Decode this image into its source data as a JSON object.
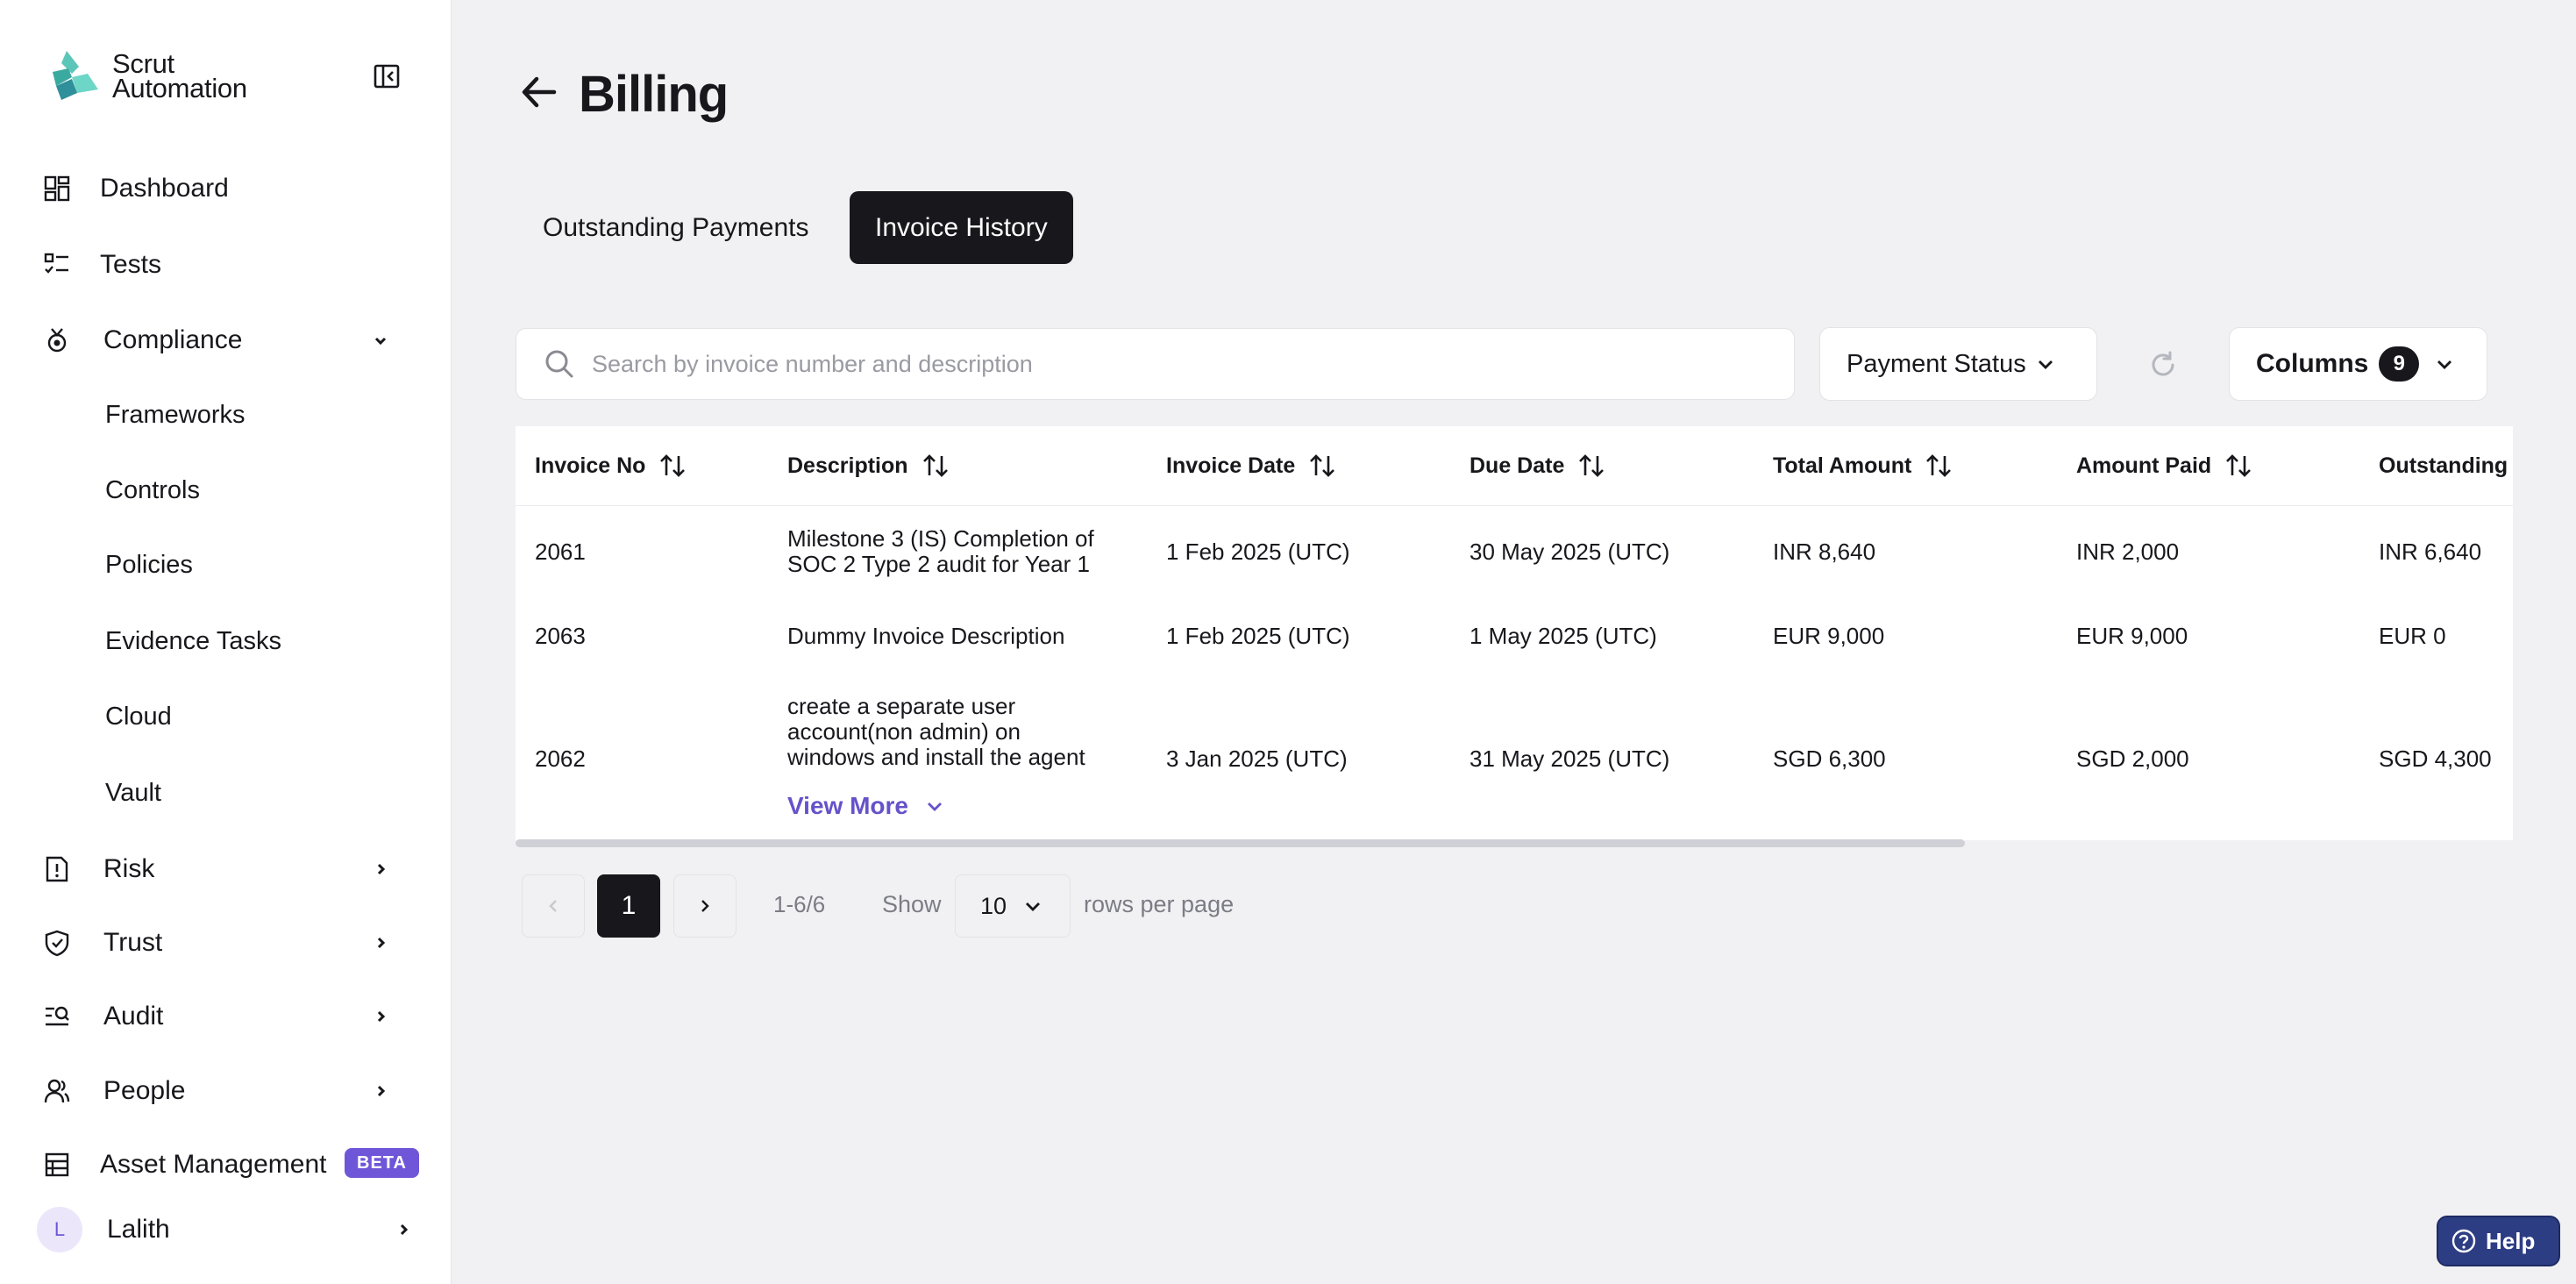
{
  "brand": {
    "name_line1": "Scrut",
    "name_line2": "Automation"
  },
  "sidebar": {
    "items": [
      {
        "label": "Dashboard"
      },
      {
        "label": "Tests"
      },
      {
        "label": "Compliance"
      },
      {
        "label": "Risk"
      },
      {
        "label": "Trust"
      },
      {
        "label": "Audit"
      },
      {
        "label": "People"
      },
      {
        "label": "Asset Management",
        "badge": "BETA"
      }
    ],
    "compliance_sub": [
      "Frameworks",
      "Controls",
      "Policies",
      "Evidence Tasks",
      "Cloud",
      "Vault"
    ],
    "user": {
      "initial": "L",
      "name": "Lalith"
    }
  },
  "page": {
    "title": "Billing"
  },
  "tabs": {
    "outstanding": "Outstanding Payments",
    "history": "Invoice History"
  },
  "search": {
    "placeholder": "Search by invoice number and description"
  },
  "filters": {
    "payment_status": "Payment Status",
    "columns_label": "Columns",
    "columns_count": "9"
  },
  "table": {
    "headers": [
      "Invoice No",
      "Description",
      "Invoice Date",
      "Due Date",
      "Total Amount",
      "Amount Paid",
      "Outstanding A"
    ],
    "rows": [
      {
        "invoice_no": "2061",
        "description": "Milestone 3 (IS) Completion of SOC 2 Type 2 audit for Year 1",
        "invoice_date": "1 Feb 2025 (UTC)",
        "due_date": "30 May 2025 (UTC)",
        "total": "INR 8,640",
        "paid": "INR 2,000",
        "outstanding": "INR 6,640"
      },
      {
        "invoice_no": "2063",
        "description": "Dummy Invoice Description",
        "invoice_date": "1 Feb 2025 (UTC)",
        "due_date": "1 May 2025 (UTC)",
        "total": "EUR 9,000",
        "paid": "EUR 9,000",
        "outstanding": "EUR 0"
      },
      {
        "invoice_no": "2062",
        "description": "create a separate user account(non admin) on windows and install the agent",
        "invoice_date": "3 Jan 2025 (UTC)",
        "due_date": "31 May 2025 (UTC)",
        "total": "SGD 6,300",
        "paid": "SGD 2,000",
        "outstanding": "SGD 4,300"
      }
    ],
    "view_more": "View More"
  },
  "pagination": {
    "current": "1",
    "range": "1-6/6",
    "show": "Show",
    "rows_per_page_value": "10",
    "rows_per_page": "rows per page"
  },
  "help": {
    "label": "Help"
  },
  "colors": {
    "accent": "#6f56d8",
    "dark": "#17171c",
    "link": "#6652c9",
    "help_bg": "#2d3d84"
  }
}
